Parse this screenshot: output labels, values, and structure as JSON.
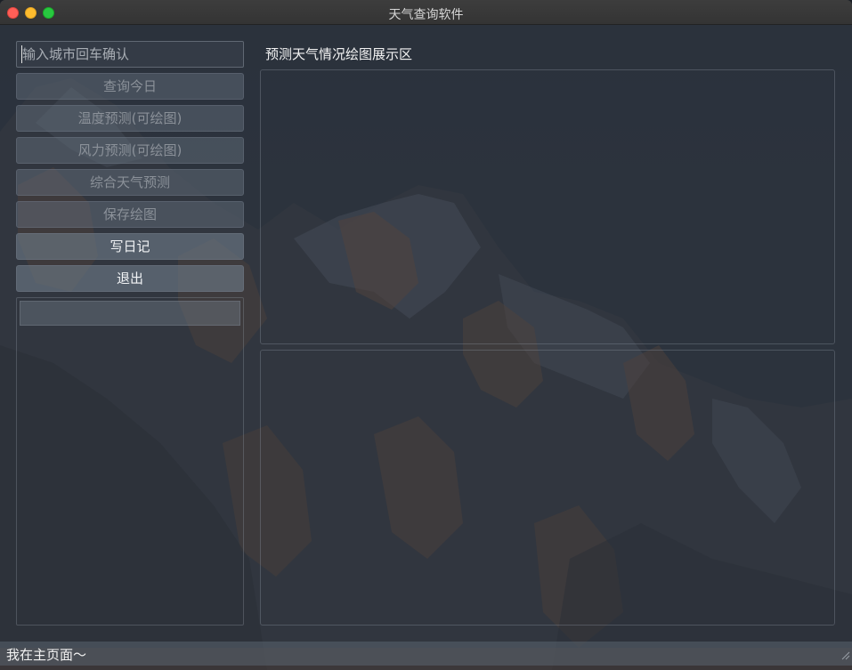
{
  "window": {
    "title": "天气查询软件"
  },
  "search": {
    "placeholder": "输入城市回车确认",
    "value": ""
  },
  "buttons": [
    {
      "label": "查询今日",
      "enabled": false
    },
    {
      "label": "温度预测(可绘图)",
      "enabled": false
    },
    {
      "label": "风力预测(可绘图)",
      "enabled": false
    },
    {
      "label": "综合天气预测",
      "enabled": false
    },
    {
      "label": "保存绘图",
      "enabled": false
    },
    {
      "label": "写日记",
      "enabled": true
    },
    {
      "label": "退出",
      "enabled": true
    }
  ],
  "main": {
    "chart_area_title": "预测天气情况绘图展示区"
  },
  "status": {
    "message": "我在主页面～"
  },
  "icons": {
    "close": "close-icon",
    "minimize": "minimize-icon",
    "maximize": "maximize-icon",
    "resize_grip": "resize-grip-icon"
  }
}
